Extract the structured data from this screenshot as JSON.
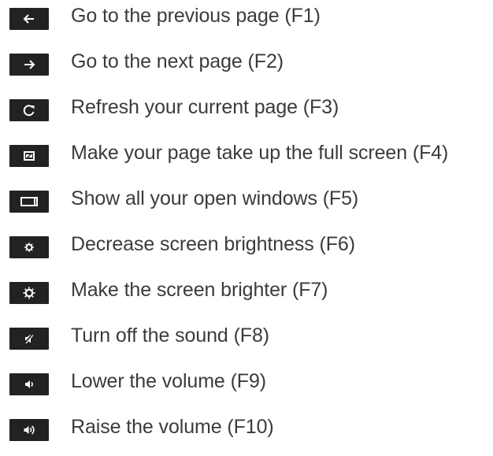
{
  "shortcuts": [
    {
      "icon": "back-arrow-icon",
      "label": "Go to the previous page (F1)"
    },
    {
      "icon": "forward-arrow-icon",
      "label": "Go to the next page (F2)"
    },
    {
      "icon": "refresh-icon",
      "label": "Refresh your current page (F3)"
    },
    {
      "icon": "fullscreen-icon",
      "label": "Make your page take up the full screen (F4)"
    },
    {
      "icon": "show-windows-icon",
      "label": "Show all your open windows (F5)"
    },
    {
      "icon": "brightness-down-icon",
      "label": "Decrease screen brightness (F6)"
    },
    {
      "icon": "brightness-up-icon",
      "label": "Make the screen brighter (F7)"
    },
    {
      "icon": "mute-icon",
      "label": "Turn off the sound (F8)"
    },
    {
      "icon": "volume-down-icon",
      "label": "Lower the volume (F9)"
    },
    {
      "icon": "volume-up-icon",
      "label": "Raise the volume (F10)"
    }
  ],
  "colors": {
    "key_background": "#222222",
    "icon": "#ffffff",
    "text": "#3b3b3b",
    "page_background": "#ffffff"
  }
}
